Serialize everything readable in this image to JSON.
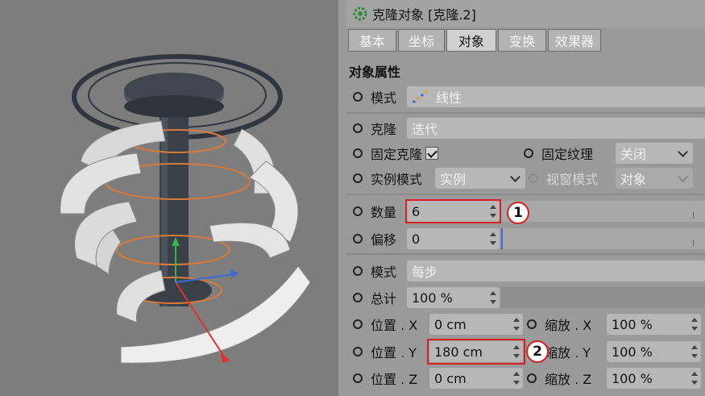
{
  "window": {
    "title": "克隆对象 [克隆.2]",
    "icon": "cloner-gear-icon"
  },
  "tabs": [
    {
      "label": "基本",
      "active": false
    },
    {
      "label": "坐标",
      "active": false
    },
    {
      "label": "对象",
      "active": true
    },
    {
      "label": "变换",
      "active": false
    },
    {
      "label": "效果器",
      "active": false
    }
  ],
  "section": {
    "title": "对象属性"
  },
  "fields": {
    "mode_top": {
      "label": "模式",
      "value": "线性",
      "icon": "linear-mode-icon"
    },
    "clone": {
      "label": "克隆",
      "value": "迭代"
    },
    "fix_clone": {
      "label": "固定克隆",
      "checked": true
    },
    "fix_texture": {
      "label": "固定纹理",
      "value": "关闭"
    },
    "instance_mode": {
      "label": "实例模式",
      "value": "实例"
    },
    "viewport_mode": {
      "label": "视窗模式",
      "value": "对象"
    },
    "count": {
      "label": "数量",
      "value": "6"
    },
    "offset": {
      "label": "偏移",
      "value": "0"
    },
    "mode_step": {
      "label": "模式",
      "value": "每步"
    },
    "total": {
      "label": "总计",
      "value": "100 %"
    },
    "pos_x": {
      "label": "位置 . X",
      "value": "0 cm"
    },
    "pos_y": {
      "label": "位置 . Y",
      "value": "180 cm"
    },
    "pos_z": {
      "label": "位置 . Z",
      "value": "0 cm"
    },
    "scale_x": {
      "label": "缩放 . X",
      "value": "100 %"
    },
    "scale_y": {
      "label": "缩放 . Y",
      "value": "100 %"
    },
    "scale_z": {
      "label": "缩放 . Z",
      "value": "100 %"
    }
  },
  "annotations": [
    {
      "number": "1",
      "target": "count"
    },
    {
      "number": "2",
      "target": "pos_y"
    }
  ],
  "colors": {
    "panel": "#9a9a9a",
    "viewport": "#7d7d7d",
    "highlight": "#d72020",
    "field": "#b7b7b7"
  }
}
